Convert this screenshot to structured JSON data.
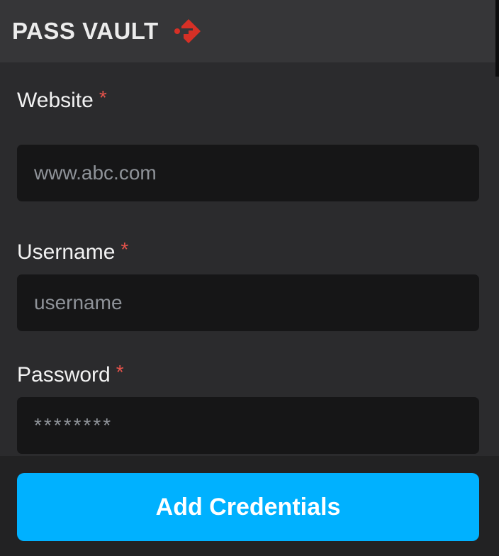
{
  "header": {
    "title": "PASS VAULT",
    "logo_icon": "key-diamond-icon",
    "logo_color": "#d63026"
  },
  "form": {
    "website": {
      "label": "Website",
      "required_mark": "*",
      "placeholder": "www.abc.com",
      "value": ""
    },
    "username": {
      "label": "Username",
      "required_mark": "*",
      "placeholder": "username",
      "value": ""
    },
    "password": {
      "label": "Password",
      "required_mark": "*",
      "placeholder": "********",
      "value": ""
    }
  },
  "actions": {
    "submit_label": "Add Credentials",
    "submit_color": "#00b1ff"
  },
  "colors": {
    "required": "#e5534b",
    "background": "#2b2b2d",
    "header": "#363638",
    "input": "#161617"
  }
}
